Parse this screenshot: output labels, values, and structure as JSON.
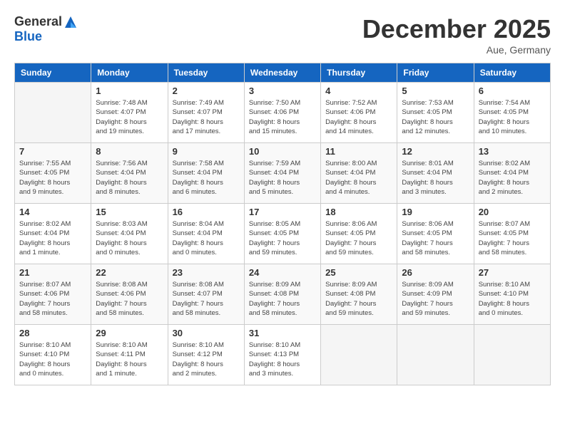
{
  "header": {
    "logo_general": "General",
    "logo_blue": "Blue",
    "month_title": "December 2025",
    "location": "Aue, Germany"
  },
  "days_of_week": [
    "Sunday",
    "Monday",
    "Tuesday",
    "Wednesday",
    "Thursday",
    "Friday",
    "Saturday"
  ],
  "weeks": [
    [
      {
        "day": "",
        "info": ""
      },
      {
        "day": "1",
        "info": "Sunrise: 7:48 AM\nSunset: 4:07 PM\nDaylight: 8 hours\nand 19 minutes."
      },
      {
        "day": "2",
        "info": "Sunrise: 7:49 AM\nSunset: 4:07 PM\nDaylight: 8 hours\nand 17 minutes."
      },
      {
        "day": "3",
        "info": "Sunrise: 7:50 AM\nSunset: 4:06 PM\nDaylight: 8 hours\nand 15 minutes."
      },
      {
        "day": "4",
        "info": "Sunrise: 7:52 AM\nSunset: 4:06 PM\nDaylight: 8 hours\nand 14 minutes."
      },
      {
        "day": "5",
        "info": "Sunrise: 7:53 AM\nSunset: 4:05 PM\nDaylight: 8 hours\nand 12 minutes."
      },
      {
        "day": "6",
        "info": "Sunrise: 7:54 AM\nSunset: 4:05 PM\nDaylight: 8 hours\nand 10 minutes."
      }
    ],
    [
      {
        "day": "7",
        "info": "Sunrise: 7:55 AM\nSunset: 4:05 PM\nDaylight: 8 hours\nand 9 minutes."
      },
      {
        "day": "8",
        "info": "Sunrise: 7:56 AM\nSunset: 4:04 PM\nDaylight: 8 hours\nand 8 minutes."
      },
      {
        "day": "9",
        "info": "Sunrise: 7:58 AM\nSunset: 4:04 PM\nDaylight: 8 hours\nand 6 minutes."
      },
      {
        "day": "10",
        "info": "Sunrise: 7:59 AM\nSunset: 4:04 PM\nDaylight: 8 hours\nand 5 minutes."
      },
      {
        "day": "11",
        "info": "Sunrise: 8:00 AM\nSunset: 4:04 PM\nDaylight: 8 hours\nand 4 minutes."
      },
      {
        "day": "12",
        "info": "Sunrise: 8:01 AM\nSunset: 4:04 PM\nDaylight: 8 hours\nand 3 minutes."
      },
      {
        "day": "13",
        "info": "Sunrise: 8:02 AM\nSunset: 4:04 PM\nDaylight: 8 hours\nand 2 minutes."
      }
    ],
    [
      {
        "day": "14",
        "info": "Sunrise: 8:02 AM\nSunset: 4:04 PM\nDaylight: 8 hours\nand 1 minute."
      },
      {
        "day": "15",
        "info": "Sunrise: 8:03 AM\nSunset: 4:04 PM\nDaylight: 8 hours\nand 0 minutes."
      },
      {
        "day": "16",
        "info": "Sunrise: 8:04 AM\nSunset: 4:04 PM\nDaylight: 8 hours\nand 0 minutes."
      },
      {
        "day": "17",
        "info": "Sunrise: 8:05 AM\nSunset: 4:05 PM\nDaylight: 7 hours\nand 59 minutes."
      },
      {
        "day": "18",
        "info": "Sunrise: 8:06 AM\nSunset: 4:05 PM\nDaylight: 7 hours\nand 59 minutes."
      },
      {
        "day": "19",
        "info": "Sunrise: 8:06 AM\nSunset: 4:05 PM\nDaylight: 7 hours\nand 58 minutes."
      },
      {
        "day": "20",
        "info": "Sunrise: 8:07 AM\nSunset: 4:05 PM\nDaylight: 7 hours\nand 58 minutes."
      }
    ],
    [
      {
        "day": "21",
        "info": "Sunrise: 8:07 AM\nSunset: 4:06 PM\nDaylight: 7 hours\nand 58 minutes."
      },
      {
        "day": "22",
        "info": "Sunrise: 8:08 AM\nSunset: 4:06 PM\nDaylight: 7 hours\nand 58 minutes."
      },
      {
        "day": "23",
        "info": "Sunrise: 8:08 AM\nSunset: 4:07 PM\nDaylight: 7 hours\nand 58 minutes."
      },
      {
        "day": "24",
        "info": "Sunrise: 8:09 AM\nSunset: 4:08 PM\nDaylight: 7 hours\nand 58 minutes."
      },
      {
        "day": "25",
        "info": "Sunrise: 8:09 AM\nSunset: 4:08 PM\nDaylight: 7 hours\nand 59 minutes."
      },
      {
        "day": "26",
        "info": "Sunrise: 8:09 AM\nSunset: 4:09 PM\nDaylight: 7 hours\nand 59 minutes."
      },
      {
        "day": "27",
        "info": "Sunrise: 8:10 AM\nSunset: 4:10 PM\nDaylight: 8 hours\nand 0 minutes."
      }
    ],
    [
      {
        "day": "28",
        "info": "Sunrise: 8:10 AM\nSunset: 4:10 PM\nDaylight: 8 hours\nand 0 minutes."
      },
      {
        "day": "29",
        "info": "Sunrise: 8:10 AM\nSunset: 4:11 PM\nDaylight: 8 hours\nand 1 minute."
      },
      {
        "day": "30",
        "info": "Sunrise: 8:10 AM\nSunset: 4:12 PM\nDaylight: 8 hours\nand 2 minutes."
      },
      {
        "day": "31",
        "info": "Sunrise: 8:10 AM\nSunset: 4:13 PM\nDaylight: 8 hours\nand 3 minutes."
      },
      {
        "day": "",
        "info": ""
      },
      {
        "day": "",
        "info": ""
      },
      {
        "day": "",
        "info": ""
      }
    ]
  ]
}
